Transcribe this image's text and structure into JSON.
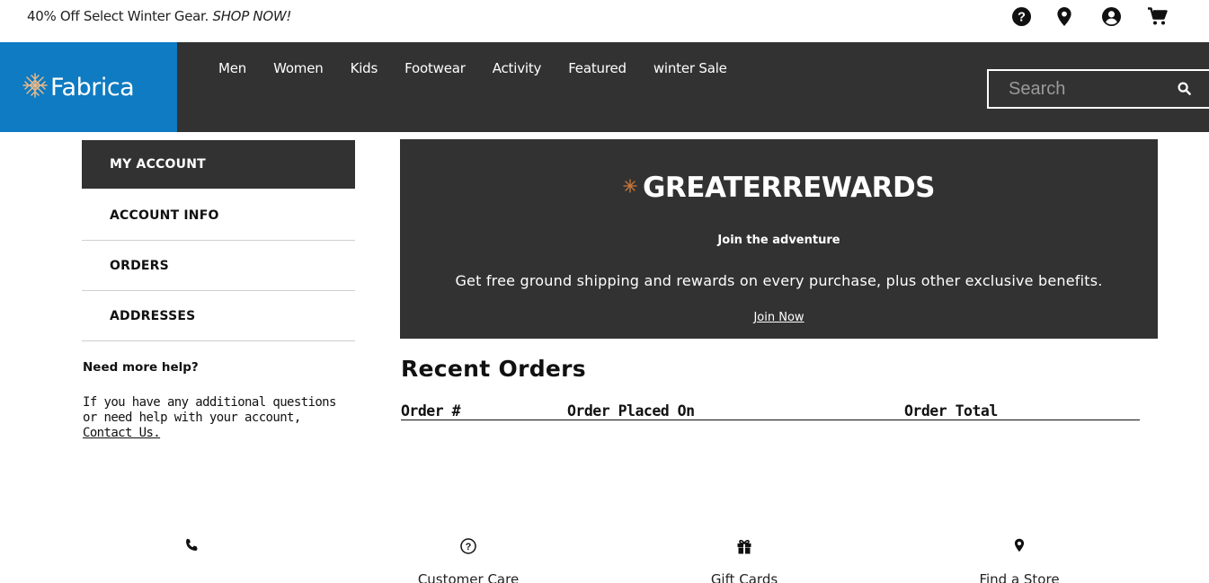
{
  "promo": {
    "text": "40% Off Select Winter Gear.",
    "cta": "SHOP NOW!"
  },
  "utility_icons": [
    "help-icon",
    "location-icon",
    "account-icon",
    "cart-icon"
  ],
  "logo": {
    "text": "Fabrica"
  },
  "nav": {
    "items": [
      "Men",
      "Women",
      "Kids",
      "Footwear",
      "Activity",
      "Featured",
      "winter Sale"
    ]
  },
  "search": {
    "placeholder": "Search",
    "value": ""
  },
  "sidebar": {
    "items": [
      {
        "label": "MY ACCOUNT",
        "active": true
      },
      {
        "label": "ACCOUNT INFO",
        "active": false
      },
      {
        "label": "ORDERS",
        "active": false
      },
      {
        "label": "ADDRESSES",
        "active": false
      }
    ],
    "help_title": "Need more help?",
    "help_text": "If you have any additional questions or need help with your account,",
    "help_link": "Contact Us."
  },
  "rewards": {
    "title": "GREATERREWARDS",
    "subtitle": "Join the adventure",
    "description": "Get free ground shipping and rewards on every purchase, plus other exclusive benefits.",
    "join": "Join Now"
  },
  "orders": {
    "title": "Recent Orders",
    "columns": [
      "Order #",
      "Order Placed On",
      "Order Total"
    ]
  },
  "footer": {
    "items": [
      {
        "label": "",
        "icon": "phone-icon"
      },
      {
        "label": "Customer Care",
        "icon": "question-circle-icon"
      },
      {
        "label": "Gift Cards",
        "icon": "gift-icon"
      },
      {
        "label": "Find a Store",
        "icon": "location-icon"
      }
    ]
  },
  "colors": {
    "brand_blue": "#0e7bc2",
    "dark_bar": "#333232",
    "accent_orange": "#c8783a"
  }
}
